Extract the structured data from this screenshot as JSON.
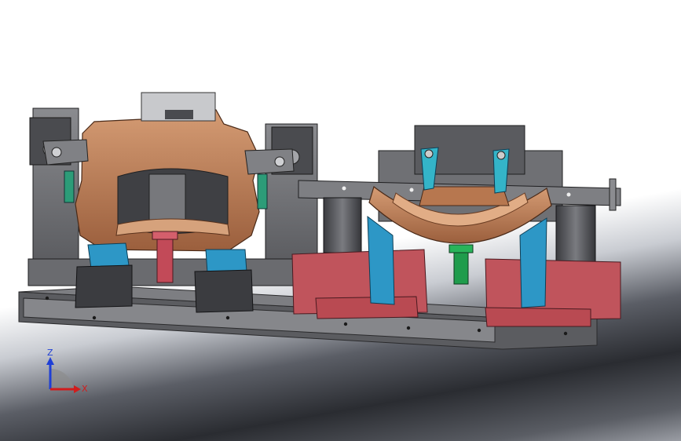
{
  "viewport": {
    "triad": {
      "z_label": "Z",
      "x_label": "X"
    }
  },
  "colors": {
    "steel": "#6f7074",
    "steel_dark": "#4e4f53",
    "copper": "#b7774f",
    "copper_light": "#d39a72",
    "blue": "#2d97c6",
    "red": "#c0545c",
    "green": "#1f9c4c",
    "triad_z": "#1f3fd6",
    "triad_x": "#d11c1c"
  }
}
